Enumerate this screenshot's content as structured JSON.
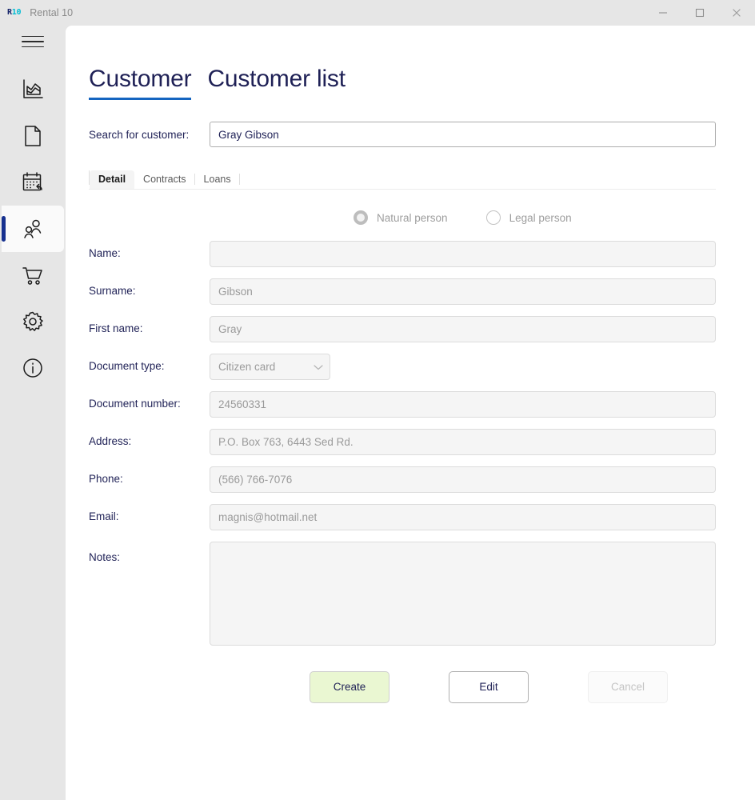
{
  "window": {
    "app_icon_primary": "R",
    "app_icon_secondary": "10",
    "title": "Rental 10",
    "controls": {
      "minimize": "minimize-button",
      "maximize": "maximize-button",
      "close": "close-button"
    }
  },
  "sidebar": {
    "menu_toggle": "hamburger-menu",
    "items": [
      {
        "name": "analytics",
        "icon": "area-chart-icon",
        "active": false
      },
      {
        "name": "documents",
        "icon": "document-icon",
        "active": false
      },
      {
        "name": "calendar-return",
        "icon": "calendar-return-icon",
        "active": false
      },
      {
        "name": "customers",
        "icon": "people-icon",
        "active": true
      },
      {
        "name": "orders",
        "icon": "shopping-cart-icon",
        "active": false
      },
      {
        "name": "settings",
        "icon": "gear-icon",
        "active": false
      },
      {
        "name": "about",
        "icon": "info-icon",
        "active": false
      }
    ]
  },
  "header": {
    "tabs": [
      {
        "label": "Customer",
        "active": true
      },
      {
        "label": "Customer list",
        "active": false
      }
    ]
  },
  "search": {
    "label": "Search for customer:",
    "value": "Gray Gibson",
    "placeholder": ""
  },
  "tabstrip": {
    "tabs": [
      {
        "label": "Detail",
        "active": true
      },
      {
        "label": "Contracts",
        "active": false
      },
      {
        "label": "Loans",
        "active": false
      }
    ]
  },
  "person_type": {
    "options": [
      {
        "label": "Natural person",
        "selected": true
      },
      {
        "label": "Legal person",
        "selected": false
      }
    ]
  },
  "form": {
    "name": {
      "label": "Name:",
      "value": "",
      "placeholder": ""
    },
    "surname": {
      "label": "Surname:",
      "value": "Gibson"
    },
    "first_name": {
      "label": "First name:",
      "value": "Gray"
    },
    "document_type": {
      "label": "Document type:",
      "value": "Citizen card"
    },
    "document_number": {
      "label": "Document number:",
      "value": "24560331"
    },
    "address": {
      "label": "Address:",
      "value": "P.O. Box 763, 6443 Sed Rd."
    },
    "phone": {
      "label": "Phone:",
      "value": "(566) 766-7076"
    },
    "email": {
      "label": "Email:",
      "value": "magnis@hotmail.net"
    },
    "notes": {
      "label": "Notes:",
      "value": ""
    }
  },
  "actions": {
    "create": "Create",
    "edit": "Edit",
    "cancel": "Cancel"
  },
  "colors": {
    "accent_blue": "#1565c0",
    "nav_indicator": "#16308f",
    "label_navy": "#1f2156",
    "create_green": "#eaf7d2",
    "icon_cyan": "#00bcd4"
  }
}
